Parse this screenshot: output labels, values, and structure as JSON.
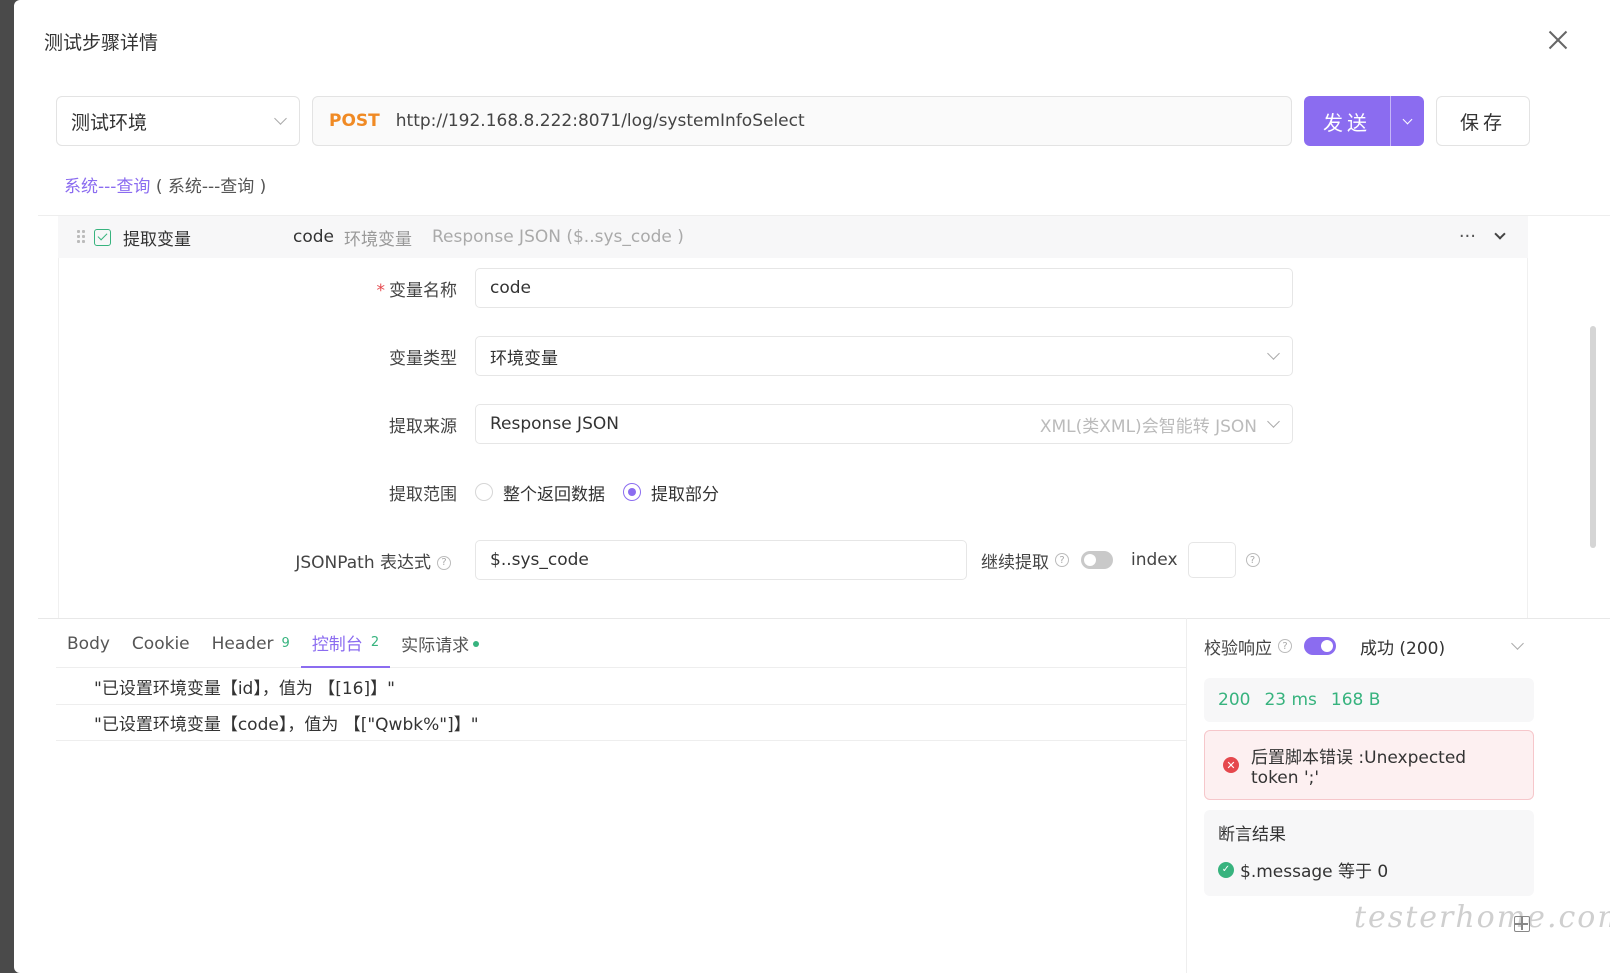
{
  "dialog": {
    "title": "测试步骤详情"
  },
  "request": {
    "env": "测试环境",
    "method": "POST",
    "url": "http://192.168.8.222:8071/log/systemInfoSelect",
    "send_label": "发送",
    "save_label": "保存"
  },
  "breadcrumb": {
    "link": "系统---查询",
    "detail": "( 系统---查询 )"
  },
  "step": {
    "name": "提取变量",
    "var": "code",
    "type": "环境变量",
    "source": "Response JSON ($..sys_code )",
    "more": "···"
  },
  "form": {
    "var_name_label": "变量名称",
    "var_name_value": "code",
    "var_type_label": "变量类型",
    "var_type_value": "环境变量",
    "source_label": "提取来源",
    "source_value": "Response JSON",
    "source_hint": "XML(类XML)会智能转 JSON",
    "scope_label": "提取范围",
    "scope_opt_all": "整个返回数据",
    "scope_opt_part": "提取部分",
    "jsonpath_label": "JSONPath 表达式",
    "jsonpath_value": "$..sys_code",
    "continue_label": "继续提取",
    "index_label": "index",
    "qmark": "?"
  },
  "tabs": [
    {
      "label": "Body"
    },
    {
      "label": "Cookie"
    },
    {
      "label": "Header",
      "count": "9"
    },
    {
      "label": "控制台",
      "count": "2"
    },
    {
      "label": "实际请求"
    }
  ],
  "console": [
    "\"已设置环境变量【id】，值为 【[16]】\"",
    "\"已设置环境变量【code】，值为 【[\"Qwbk%\"]】\""
  ],
  "validate": {
    "label": "校验响应",
    "status": "成功 (200)",
    "code": "200",
    "time": "23 ms",
    "size": "168 B",
    "error": "后置脚本错误 :Unexpected token ';'",
    "assert_title": "断言结果",
    "assert_item": "$.message 等于 0"
  },
  "watermark": "testerhome.com",
  "colors": {
    "accent": "#8b6cf0",
    "success": "#37b37e",
    "method": "#f08a24",
    "error": "#e5484d"
  }
}
